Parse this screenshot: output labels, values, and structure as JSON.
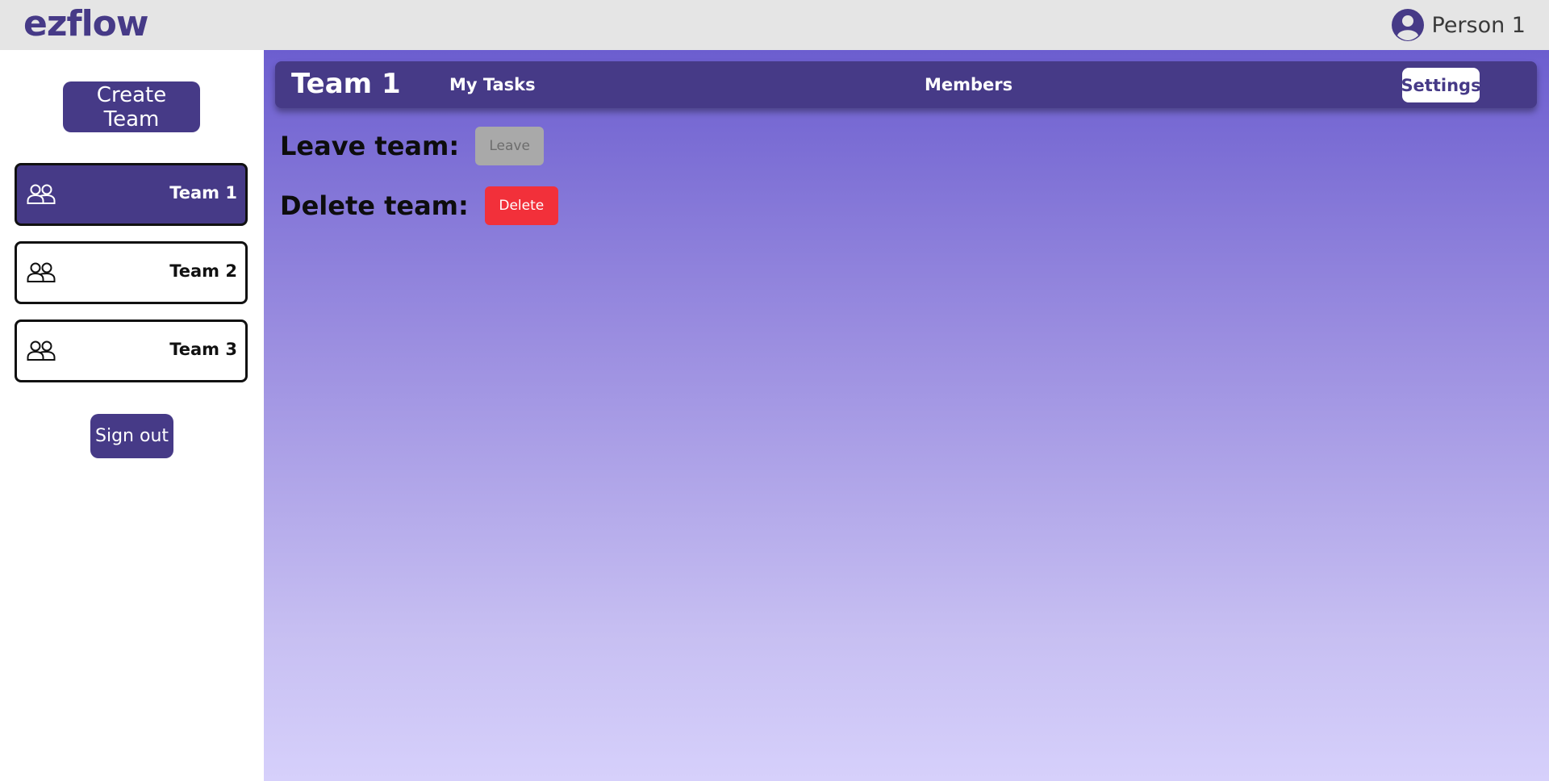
{
  "app": {
    "logo": "ezflow"
  },
  "user": {
    "name": "Person 1",
    "icon": "user-circle-icon"
  },
  "sidebar": {
    "create_team_label": "Create Team",
    "teams": [
      {
        "label": "Team 1",
        "icon": "users-icon",
        "active": true
      },
      {
        "label": "Team 2",
        "icon": "users-icon",
        "active": false
      },
      {
        "label": "Team 3",
        "icon": "users-icon",
        "active": false
      }
    ],
    "sign_out_label": "Sign out"
  },
  "team_header": {
    "title": "Team 1",
    "tabs": [
      {
        "label": "My Tasks",
        "active": false
      },
      {
        "label": "Members",
        "active": false
      },
      {
        "label": "Settings",
        "active": true
      }
    ]
  },
  "settings": {
    "leave_label": "Leave team:",
    "leave_button": "Leave",
    "leave_disabled": true,
    "delete_label": "Delete team:",
    "delete_button": "Delete"
  },
  "colors": {
    "brand": "#463a87",
    "topbar_bg": "#e5e5e5",
    "danger": "#f2303a",
    "disabled": "#a9a9a9",
    "gradient_top": "#6c5ecf",
    "gradient_bottom": "#d6d0fb"
  }
}
